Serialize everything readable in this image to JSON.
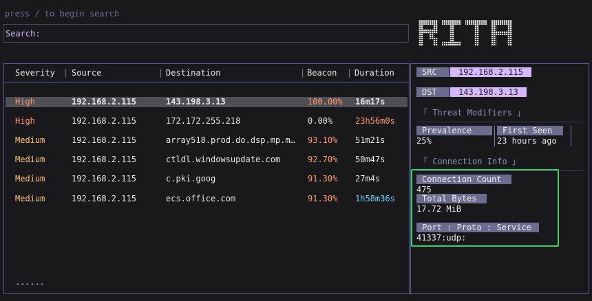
{
  "search": {
    "hint": "press / to begin search",
    "label": "Search:",
    "value": ""
  },
  "logo": {
    "text": "RITA"
  },
  "columns": {
    "severity": "Severity",
    "source": "Source",
    "destination": "Destination",
    "beacon": "Beacon",
    "duration": "Duration"
  },
  "rows": [
    {
      "severity": "High",
      "source": "192.168.2.115",
      "destination": "143.198.3.13",
      "beacon": "100.00%",
      "duration": "16m17s"
    },
    {
      "severity": "High",
      "source": "192.168.2.115",
      "destination": "172.172.255.218",
      "beacon": "0.00%",
      "duration": "23h56m0s"
    },
    {
      "severity": "Medium",
      "source": "192.168.2.115",
      "destination": "array518.prod.do.dsp.mp.mi…",
      "beacon": "93.10%",
      "duration": "51m21s"
    },
    {
      "severity": "Medium",
      "source": "192.168.2.115",
      "destination": "ctldl.windowsupdate.com",
      "beacon": "92.70%",
      "duration": "50m47s"
    },
    {
      "severity": "Medium",
      "source": "192.168.2.115",
      "destination": "c.pki.goog",
      "beacon": "91.30%",
      "duration": "27m4s"
    },
    {
      "severity": "Medium",
      "source": "192.168.2.115",
      "destination": "ecs.office.com",
      "beacon": "91.30%",
      "duration": "1h58m36s"
    }
  ],
  "pager": "••••••",
  "detail": {
    "src_label": "SRC",
    "src_value": "192.168.2.115",
    "dst_label": "DST",
    "dst_value": "143.198.3.13",
    "threat_modifiers_title": "「 Threat Modifiers 」",
    "prevalence_label": "Prevalence",
    "prevalence_value": "25%",
    "first_seen_label": "First Seen",
    "first_seen_value": "23 hours ago",
    "connection_info_title": "「 Connection Info 」",
    "connection_count_label": "Connection Count",
    "connection_count_value": "475",
    "total_bytes_label": "Total Bytes",
    "total_bytes_value": "17.72 MiB",
    "port_label": "Port : Proto : Service",
    "port_value": "41337:udp:"
  },
  "colors": {
    "high": "#ff9a6a",
    "medium": "#ffc473",
    "beacon_hot": "#ff9a6a",
    "beacon_cold": "#e6e6ea",
    "duration_long": "#ff9a6a",
    "duration_cyan": "#6fd3f5",
    "accent": "#d5b8ff",
    "highlight": "#3fd06a"
  }
}
